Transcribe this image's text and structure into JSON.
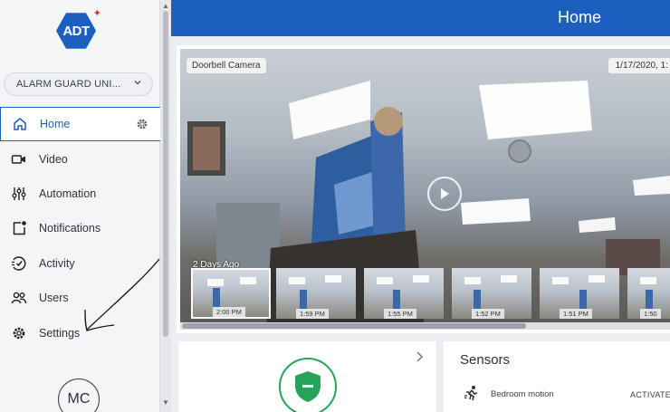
{
  "brand": {
    "logo_text": "ADT",
    "logo_color": "#1b5fbf",
    "accent_leaf": "#d62c2c"
  },
  "account": {
    "name": "ALARM GUARD UNI...",
    "icon": "chevron-down-icon"
  },
  "sidebar": {
    "items": [
      {
        "label": "Home",
        "icon": "home-icon",
        "active": true
      },
      {
        "label": "Video",
        "icon": "video-camera-icon"
      },
      {
        "label": "Automation",
        "icon": "sliders-icon"
      },
      {
        "label": "Notifications",
        "icon": "notification-icon"
      },
      {
        "label": "Activity",
        "icon": "activity-icon"
      },
      {
        "label": "Users",
        "icon": "users-icon"
      },
      {
        "label": "Settings",
        "icon": "gear-icon"
      }
    ],
    "avatar_initials": "MC"
  },
  "header": {
    "title": "Home",
    "color": "#1b5fbf"
  },
  "camera": {
    "label": "Doorbell Camera",
    "date": "1/17/2020, 1:",
    "ago_label": "2 Days Ago",
    "thumbnails": [
      {
        "time": "2:00 PM",
        "selected": true
      },
      {
        "time": "1:59 PM"
      },
      {
        "time": "1:55 PM"
      },
      {
        "time": "1:52 PM"
      },
      {
        "time": "1:51 PM"
      },
      {
        "time": "1:50"
      }
    ]
  },
  "security": {
    "icon": "shield-icon",
    "status_color": "#27a35a"
  },
  "sensors": {
    "title": "Sensors",
    "rows": [
      {
        "name": "Bedroom motion",
        "status": "ACTIVATED",
        "icon": "motion-icon"
      }
    ]
  }
}
